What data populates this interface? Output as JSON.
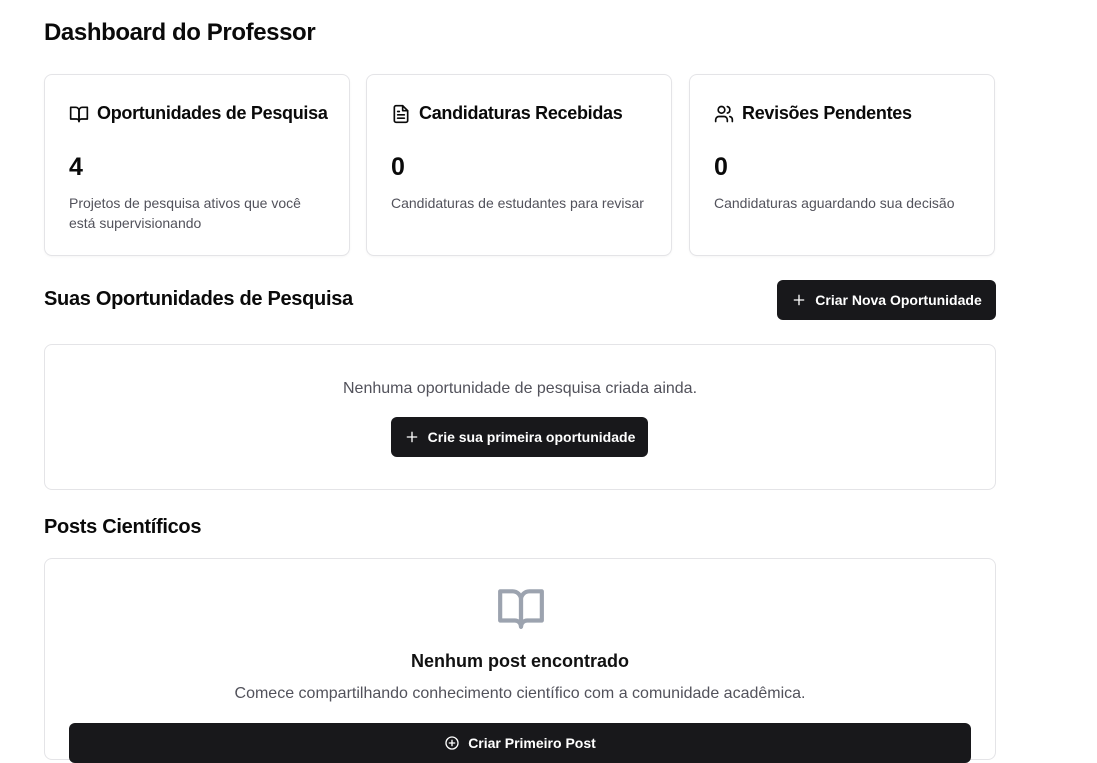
{
  "page_title": "Dashboard do Professor",
  "stats": [
    {
      "icon": "book-open-icon",
      "title": "Oportunidades de Pesquisa",
      "value": "4",
      "description": "Projetos de pesquisa ativos que você está supervisionando"
    },
    {
      "icon": "file-text-icon",
      "title": "Candidaturas Recebidas",
      "value": "0",
      "description": "Candidaturas de estudantes para revisar"
    },
    {
      "icon": "users-icon",
      "title": "Revisões Pendentes",
      "value": "0",
      "description": "Candidaturas aguardando sua decisão"
    }
  ],
  "opportunities": {
    "title": "Suas Oportunidades de Pesquisa",
    "create_button": "Criar Nova Oportunidade",
    "empty_text": "Nenhuma oportunidade de pesquisa criada ainda.",
    "empty_button": "Crie sua primeira oportunidade"
  },
  "posts": {
    "title": "Posts Científicos",
    "empty_icon": "book-open-icon",
    "empty_title": "Nenhum post encontrado",
    "empty_text": "Comece compartilhando conhecimento científico com a comunidade acadêmica.",
    "create_button": "Criar Primeiro Post"
  },
  "colors": {
    "primary_button": "#18181b",
    "border": "#e4e4e7",
    "muted_text": "#52525b"
  }
}
